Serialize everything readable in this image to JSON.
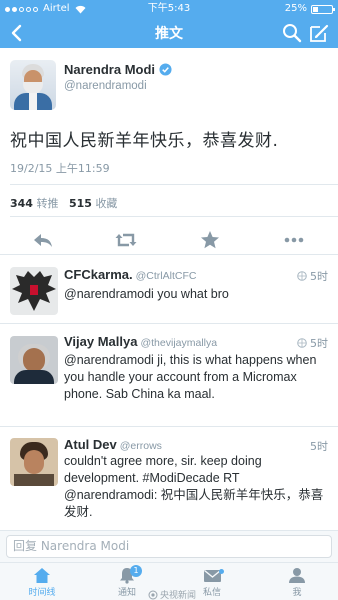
{
  "status_bar": {
    "carrier": "Airtel",
    "time": "下午5:43",
    "battery": "25%"
  },
  "nav": {
    "title": "推文"
  },
  "tweet": {
    "name": "Narendra Modi",
    "handle": "@narendramodi",
    "text": "祝中国人民新羊年快乐，恭喜发财.",
    "timestamp": "19/2/15 上午11:59",
    "retweets": "344",
    "retweets_label": "转推",
    "favorites": "515",
    "favorites_label": "收藏"
  },
  "replies": [
    {
      "name": "CFCkarma.",
      "handle": "@CtrlAltCFC",
      "time": "5时",
      "text": "@narendramodi you what bro"
    },
    {
      "name": "Vijay Mallya",
      "handle": "@thevijaymallya",
      "time": "5时",
      "text": "@narendramodi ji, this is what happens when you handle your account from a Micromax phone. Sab China ka maal."
    },
    {
      "name": "Atul Dev",
      "handle": "@errows",
      "time": "5时",
      "text": "couldn't agree more, sir. keep doing development. #ModiDecade RT @narendramodi: 祝中国人民新羊年快乐，恭喜发财."
    }
  ],
  "reply_input": {
    "placeholder": "回复 Narendra Modi"
  },
  "tabs": [
    {
      "label": "时间线",
      "icon": "home-icon"
    },
    {
      "label": "通知",
      "icon": "bell-icon",
      "badge": "1"
    },
    {
      "label": "私信",
      "icon": "mail-icon"
    },
    {
      "label": "我",
      "icon": "profile-icon"
    }
  ],
  "watermark": "央视新闻",
  "colors": {
    "accent": "#55acee",
    "text": "#292f33",
    "muted": "#8899a6"
  }
}
